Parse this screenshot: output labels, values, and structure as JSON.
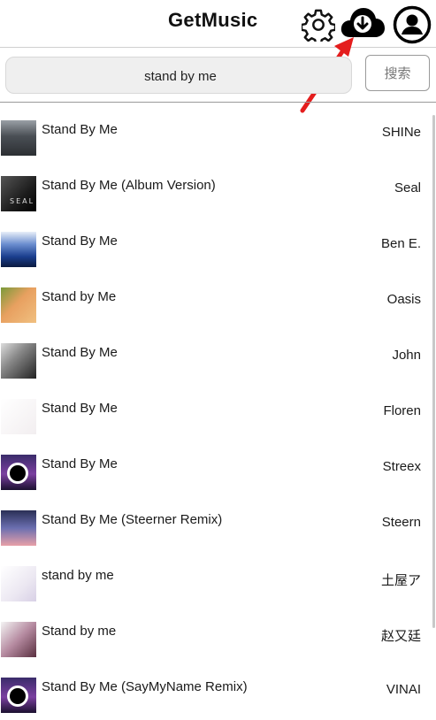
{
  "header": {
    "title": "GetMusic"
  },
  "search": {
    "value": "stand by me",
    "button_label": "搜索"
  },
  "results": [
    {
      "song": "Stand By Me",
      "artist": "SHINe",
      "thumb": "bg-group"
    },
    {
      "song": "Stand By Me (Album Version)",
      "artist": "Seal",
      "thumb": "bg-dark",
      "thumb_text": "SEAL"
    },
    {
      "song": "Stand By Me",
      "artist": "Ben E.",
      "thumb": "bg-blue"
    },
    {
      "song": "Stand by Me",
      "artist": "Oasis",
      "thumb": "bg-orange"
    },
    {
      "song": "Stand By Me",
      "artist": "John",
      "thumb": "bg-bw"
    },
    {
      "song": "Stand By Me",
      "artist": "Floren",
      "thumb": "bg-white"
    },
    {
      "song": "Stand By Me",
      "artist": "Streex",
      "thumb": "bg-purple"
    },
    {
      "song": "Stand By Me (Steerner Remix)",
      "artist": "Steern",
      "thumb": "bg-sunset"
    },
    {
      "song": "stand by me",
      "artist": "土屋ア",
      "thumb": "bg-pale"
    },
    {
      "song": "Stand by me",
      "artist": "赵又廷",
      "thumb": "bg-photo"
    },
    {
      "song": "Stand By Me (SayMyName Remix)",
      "artist": "VINAI",
      "thumb": "bg-purple"
    }
  ],
  "colors": {
    "accent_arrow": "#e41d1d",
    "divider": "#9a9a9a"
  }
}
